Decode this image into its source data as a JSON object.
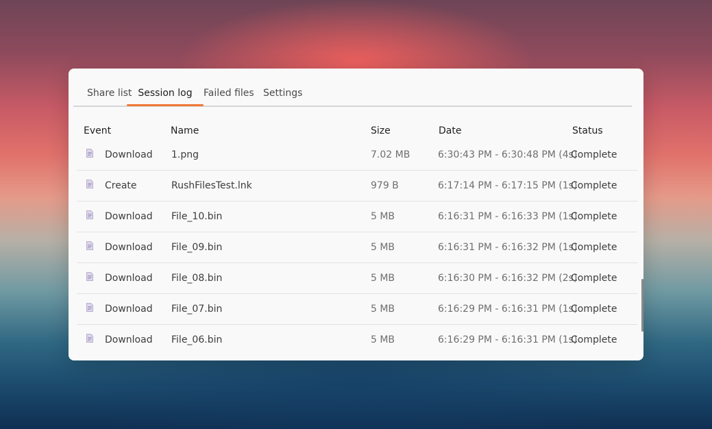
{
  "tabs": [
    {
      "label": "Share list",
      "active": false
    },
    {
      "label": "Session log",
      "active": true
    },
    {
      "label": "Failed files",
      "active": false
    },
    {
      "label": "Settings",
      "active": false
    }
  ],
  "accent_color": "#f07a38",
  "table": {
    "columns": {
      "event": "Event",
      "name": "Name",
      "size": "Size",
      "date": "Date",
      "status": "Status"
    },
    "rows": [
      {
        "icon": "file-icon",
        "event": "Download",
        "name": "1.png",
        "size": "7.02 MB",
        "date": "6:30:43 PM - 6:30:48 PM (4s)",
        "status": "Complete"
      },
      {
        "icon": "file-icon",
        "event": "Create",
        "name": "RushFilesTest.lnk",
        "size": "979 B",
        "date": "6:17:14 PM - 6:17:15 PM (1s)",
        "status": "Complete"
      },
      {
        "icon": "file-icon",
        "event": "Download",
        "name": "File_10.bin",
        "size": "5 MB",
        "date": "6:16:31 PM - 6:16:33 PM (1s)",
        "status": "Complete"
      },
      {
        "icon": "file-icon",
        "event": "Download",
        "name": "File_09.bin",
        "size": "5 MB",
        "date": "6:16:31 PM - 6:16:32 PM (1s)",
        "status": "Complete"
      },
      {
        "icon": "file-icon",
        "event": "Download",
        "name": "File_08.bin",
        "size": "5 MB",
        "date": "6:16:30 PM - 6:16:32 PM (2s)",
        "status": "Complete"
      },
      {
        "icon": "file-icon",
        "event": "Download",
        "name": "File_07.bin",
        "size": "5 MB",
        "date": "6:16:29 PM - 6:16:31 PM (1s)",
        "status": "Complete"
      },
      {
        "icon": "file-icon",
        "event": "Download",
        "name": "File_06.bin",
        "size": "5 MB",
        "date": "6:16:29 PM - 6:16:31 PM (1s)",
        "status": "Complete"
      }
    ]
  }
}
